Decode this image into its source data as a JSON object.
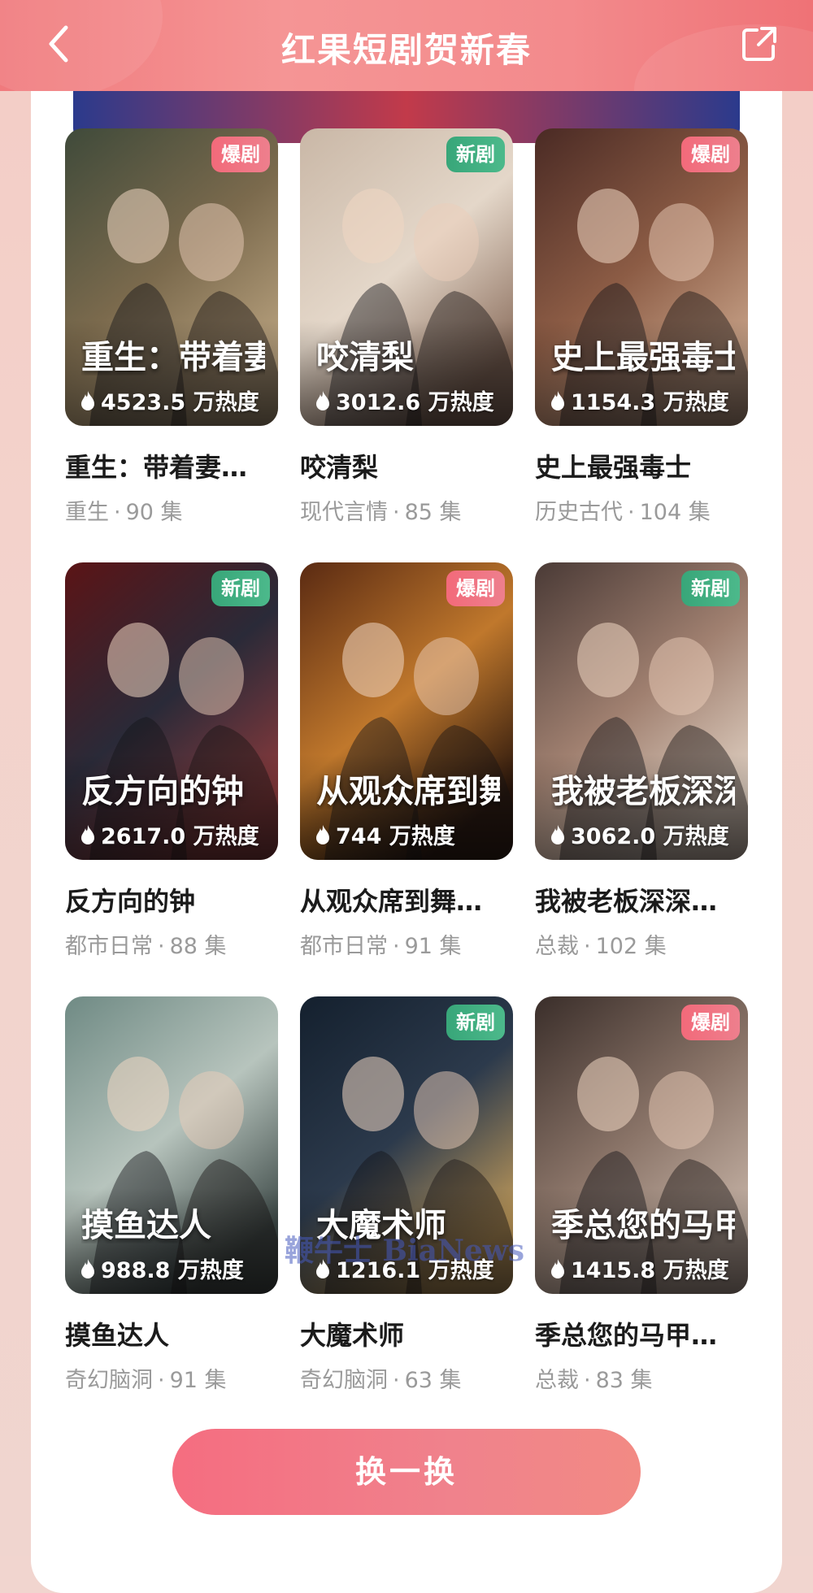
{
  "header": {
    "title": "红果短剧贺新春",
    "back_icon": "chevron-left-icon",
    "share_icon": "share-external-icon"
  },
  "dramas": [
    {
      "badge": "爆剧",
      "badge_type": "hot",
      "poster_title": "重生：带着妻儿走向致富路",
      "heat": "4523.5 万热度",
      "title": "重生：带着妻…",
      "genre": "重生",
      "episodes": "90 集",
      "palette": [
        "#3f4a3a",
        "#7b6a4d",
        "#b9a27f"
      ]
    },
    {
      "badge": "新剧",
      "badge_type": "new",
      "poster_title": "咬清梨",
      "heat": "3012.6 万热度",
      "title": "咬清梨",
      "genre": "现代言情",
      "episodes": "85 集",
      "palette": [
        "#c9b7a6",
        "#e4d7c9",
        "#8b6e5d"
      ]
    },
    {
      "badge": "爆剧",
      "badge_type": "hot",
      "poster_title": "史上最强毒士",
      "heat": "1154.3 万热度",
      "title": "史上最强毒士",
      "genre": "历史古代",
      "episodes": "104 集",
      "palette": [
        "#4a2a24",
        "#8c5c45",
        "#c9a48a"
      ]
    },
    {
      "badge": "新剧",
      "badge_type": "new",
      "poster_title": "反方向的钟",
      "heat": "2617.0 万热度",
      "title": "反方向的钟",
      "genre": "都市日常",
      "episodes": "88 集",
      "palette": [
        "#5b1416",
        "#2a2a38",
        "#8a3a3c"
      ]
    },
    {
      "badge": "爆剧",
      "badge_type": "hot",
      "poster_title": "从观众席到舞台 吓懵现场歌手",
      "heat": "744 万热度",
      "title": "从观众席到舞…",
      "genre": "都市日常",
      "episodes": "91 集",
      "palette": [
        "#5a2a12",
        "#c0782c",
        "#2a160c"
      ]
    },
    {
      "badge": "新剧",
      "badge_type": "new",
      "poster_title": "我被老板深深溺爱",
      "heat": "3062.0 万热度",
      "title": "我被老板深深…",
      "genre": "总裁",
      "episodes": "102 集",
      "palette": [
        "#4a3a36",
        "#a08070",
        "#e0d0c2"
      ]
    },
    {
      "badge": "",
      "badge_type": "none",
      "poster_title": "摸鱼达人",
      "heat": "988.8 万热度",
      "title": "摸鱼达人",
      "genre": "奇幻脑洞",
      "episodes": "91 集",
      "palette": [
        "#6f8a84",
        "#b7c4bd",
        "#3e4a48"
      ]
    },
    {
      "badge": "新剧",
      "badge_type": "new",
      "poster_title": "大魔术师",
      "heat": "1216.1 万热度",
      "title": "大魔术师",
      "genre": "奇幻脑洞",
      "episodes": "63 集",
      "palette": [
        "#14202e",
        "#2c3a4c",
        "#c09a5a"
      ]
    },
    {
      "badge": "爆剧",
      "badge_type": "hot",
      "poster_title": "季总您的马甲",
      "heat": "1415.8 万热度",
      "title": "季总您的马甲…",
      "genre": "总裁",
      "episodes": "83 集",
      "palette": [
        "#3a2e2a",
        "#8a7468",
        "#c6b3a6"
      ]
    }
  ],
  "refresh_label": "换一换",
  "watermark": "鞭牛士 BiaNews"
}
